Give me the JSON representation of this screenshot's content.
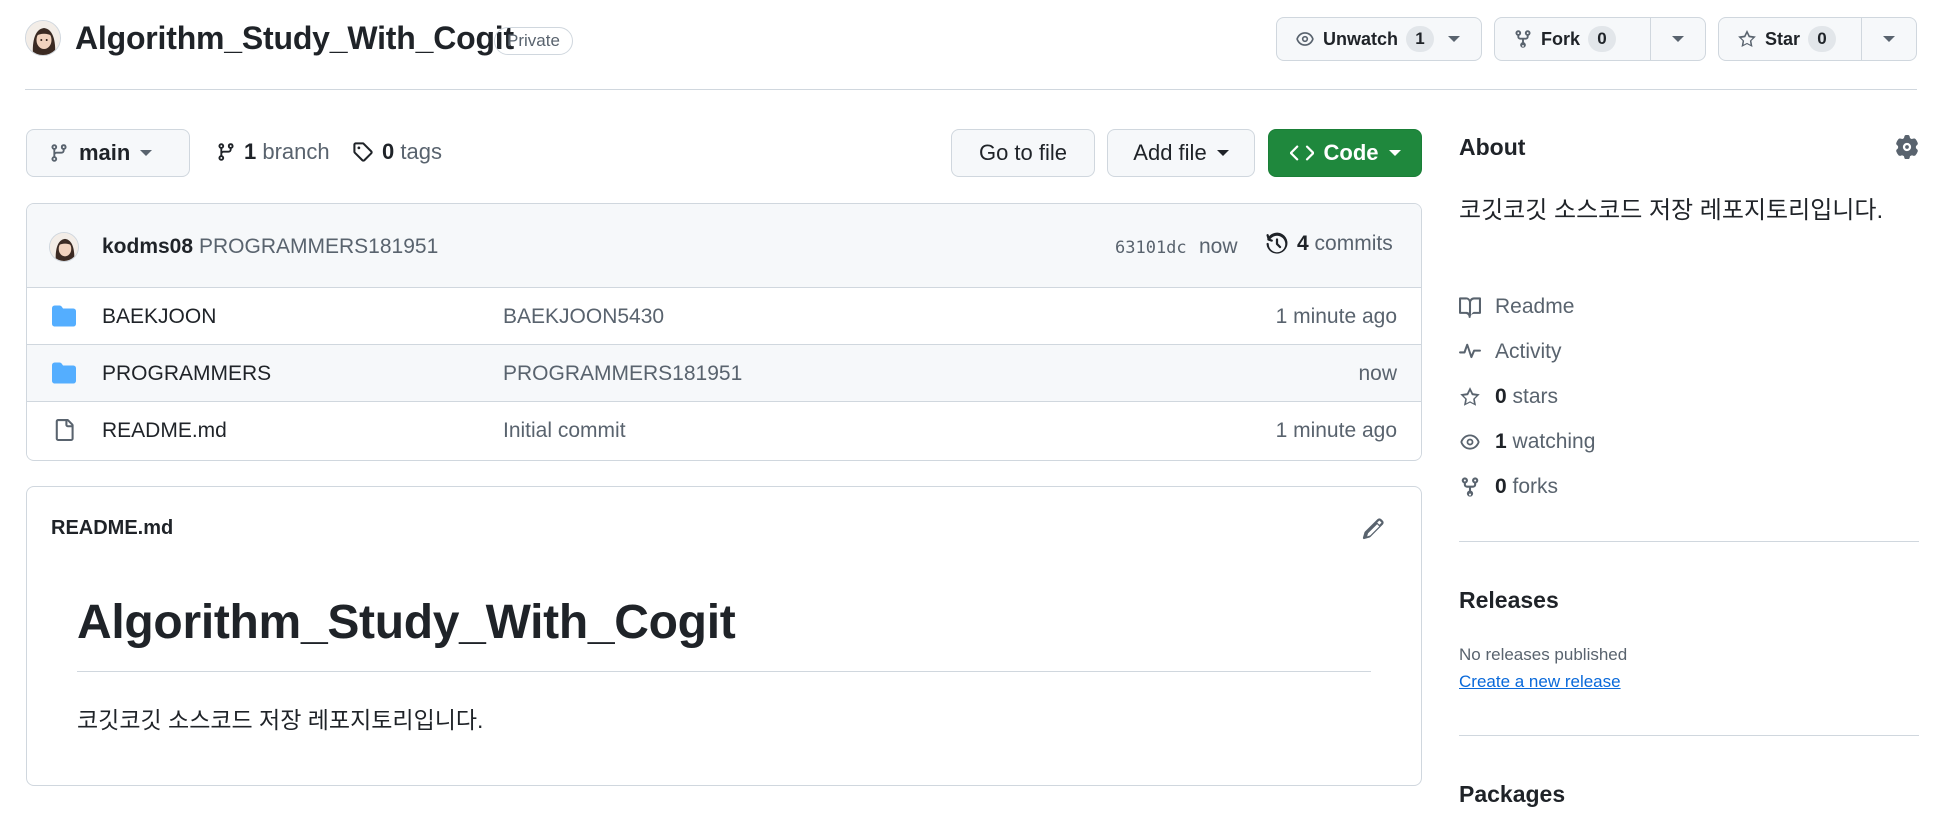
{
  "repo": {
    "name": "Algorithm_Study_With_Cogit",
    "visibility": "Private"
  },
  "header_actions": {
    "watch": {
      "label": "Unwatch",
      "count": "1"
    },
    "fork": {
      "label": "Fork",
      "count": "0"
    },
    "star": {
      "label": "Star",
      "count": "0"
    }
  },
  "toolbar": {
    "branch": "main",
    "branches": {
      "count": "1",
      "label": "branch"
    },
    "tags": {
      "count": "0",
      "label": "tags"
    },
    "go_to_file": "Go to file",
    "add_file": "Add file",
    "code": "Code"
  },
  "latest_commit": {
    "author": "kodms08",
    "message": "PROGRAMMERS181951",
    "sha": "63101dc",
    "time": "now",
    "commit_count": "4",
    "commit_label": "commits"
  },
  "files": [
    {
      "name": "BAEKJOON",
      "type": "folder",
      "message": "BAEKJOON5430",
      "time": "1 minute ago"
    },
    {
      "name": "PROGRAMMERS",
      "type": "folder",
      "message": "PROGRAMMERS181951",
      "time": "now"
    },
    {
      "name": "README.md",
      "type": "file",
      "message": "Initial commit",
      "time": "1 minute ago"
    }
  ],
  "readme": {
    "filename": "README.md",
    "heading": "Algorithm_Study_With_Cogit",
    "body": "코깃코깃 소스코드 저장 레포지토리입니다."
  },
  "about": {
    "title": "About",
    "description": "코깃코깃 소스코드 저장 레포지토리입니다.",
    "readme_label": "Readme",
    "activity_label": "Activity",
    "stars": {
      "count": "0",
      "label": "stars"
    },
    "watching": {
      "count": "1",
      "label": "watching"
    },
    "forks": {
      "count": "0",
      "label": "forks"
    }
  },
  "releases": {
    "title": "Releases",
    "empty_text": "No releases published",
    "create_link": "Create a new release"
  },
  "packages": {
    "title": "Packages"
  },
  "colors": {
    "accent_green": "#1f883d",
    "folder_blue": "#54aeff",
    "link_blue": "#0969da"
  }
}
